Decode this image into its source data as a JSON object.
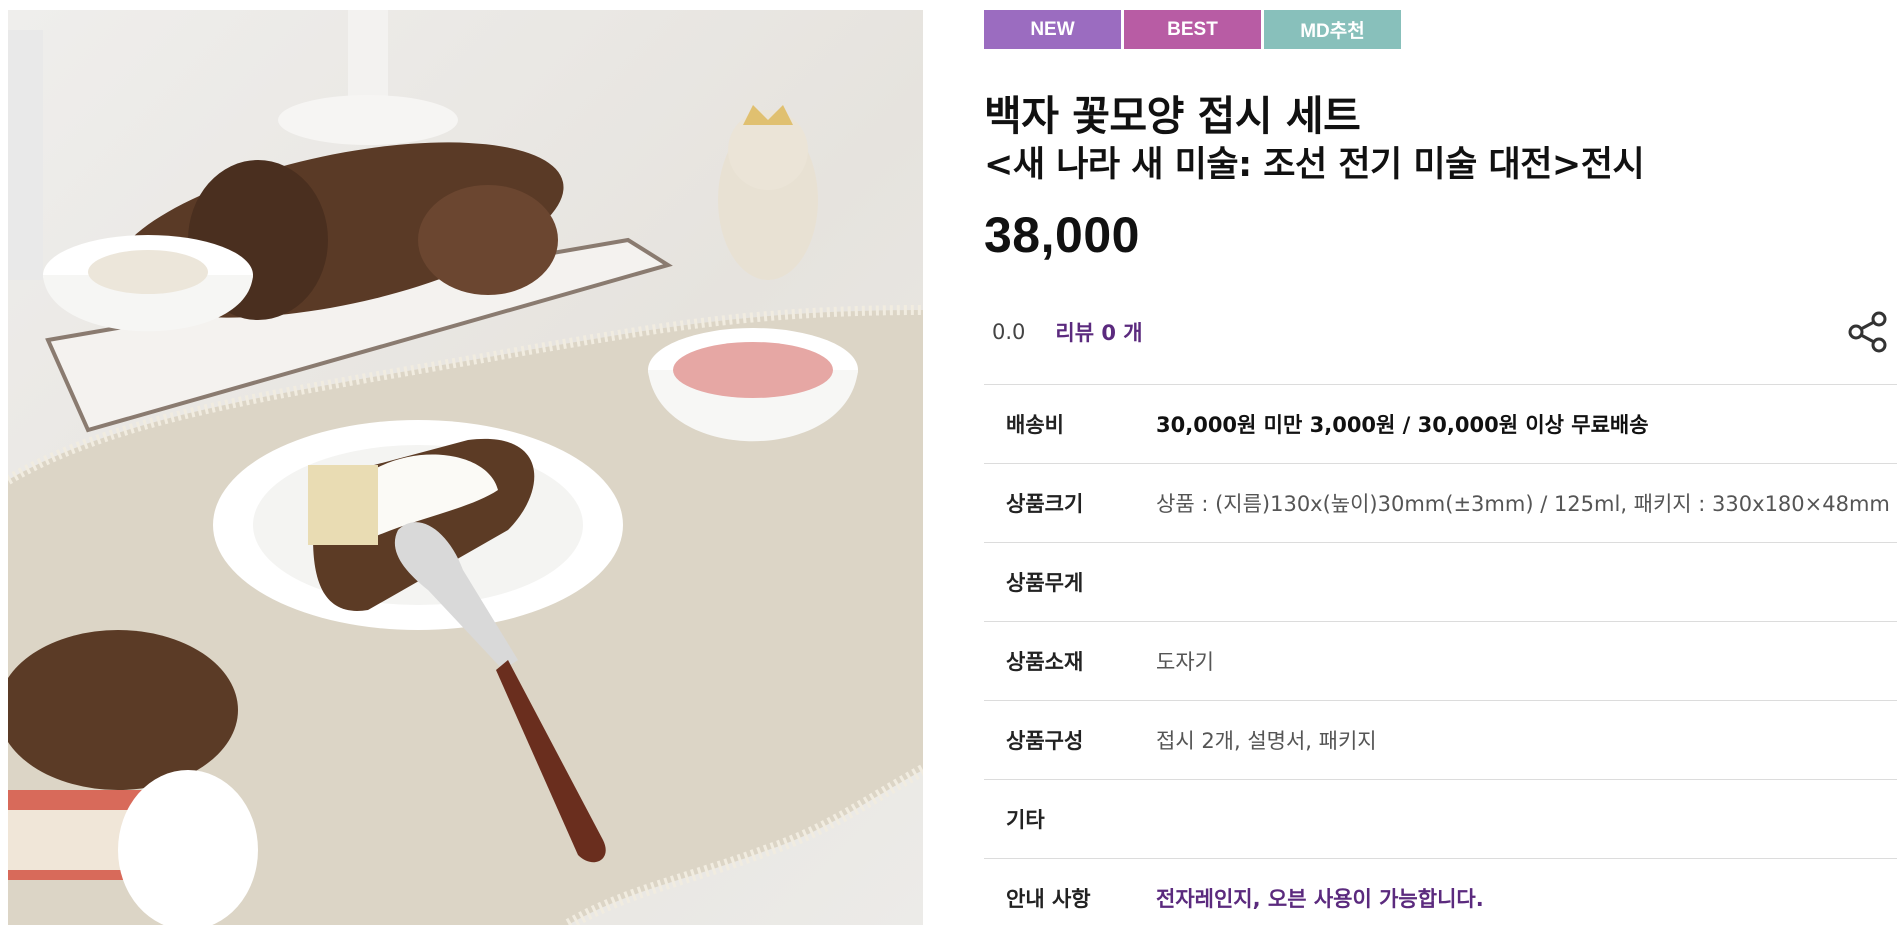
{
  "photo": {
    "alt": ""
  },
  "badges": [
    {
      "label": "NEW",
      "color": "#9b6cc0"
    },
    {
      "label": "BEST",
      "color": "#b85ca4"
    },
    {
      "label": "MD추천",
      "color": "#88c0bb"
    }
  ],
  "product": {
    "title_line1": "백자 꽃모양 접시 세트",
    "title_line2": "<새 나라 새 미술: 조선 전기 미술 대전>전시",
    "price": "38,000"
  },
  "rating": {
    "score": "0.0",
    "review_label": "리뷰 0 개"
  },
  "share_icon": "share-icon",
  "specs": [
    {
      "key": "배송비",
      "value": "30,000원 미만 3,000원 / 30,000원 이상 무료배송",
      "style": "bold"
    },
    {
      "key": "상품크기",
      "value": "상품 : (지름)130x(높이)30mm(±3mm) / 125ml, 패키지 : 330x180×48mm",
      "style": "normal"
    },
    {
      "key": "상품무게",
      "value": "",
      "style": "normal"
    },
    {
      "key": "상품소재",
      "value": "도자기",
      "style": "normal"
    },
    {
      "key": "상품구성",
      "value": "접시 2개, 설명서, 패키지",
      "style": "normal"
    },
    {
      "key": "기타",
      "value": "",
      "style": "normal"
    },
    {
      "key": "안내 사항",
      "value": "전자레인지, 오븐 사용이 가능합니다.",
      "style": "purple"
    }
  ],
  "colors": {
    "accent": "#5b2a7e",
    "divider": "#dcdcdc"
  }
}
